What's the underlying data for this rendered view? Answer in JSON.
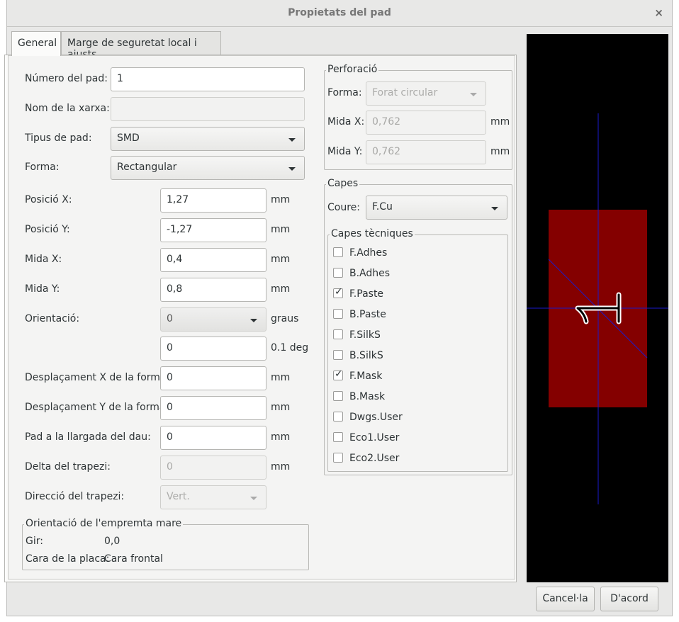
{
  "window": {
    "title": "Propietats del pad",
    "close_glyph": "×"
  },
  "tabs": [
    {
      "label": "General",
      "active": true
    },
    {
      "label": "Marge de seguretat local i ajusts",
      "active": false
    }
  ],
  "general": {
    "pad_number": {
      "label": "Número del pad:",
      "value": "1"
    },
    "net_name": {
      "label": "Nom de la xarxa:",
      "value": ""
    },
    "pad_type": {
      "label": "Tipus de pad:",
      "value": "SMD"
    },
    "shape": {
      "label": "Forma:",
      "value": "Rectangular"
    },
    "pos_x": {
      "label": "Posició X:",
      "value": "1,27",
      "unit": "mm"
    },
    "pos_y": {
      "label": "Posició Y:",
      "value": "-1,27",
      "unit": "mm"
    },
    "size_x": {
      "label": "Mida X:",
      "value": "0,4",
      "unit": "mm"
    },
    "size_y": {
      "label": "Mida Y:",
      "value": "0,8",
      "unit": "mm"
    },
    "orientation": {
      "label": "Orientació:",
      "value": "0",
      "unit": "graus",
      "value2": "0",
      "unit2": "0.1 deg"
    },
    "offset_x": {
      "label": "Desplaçament X de la forma:",
      "value": "0",
      "unit": "mm"
    },
    "offset_y": {
      "label": "Desplaçament Y de la forma:",
      "value": "0",
      "unit": "mm"
    },
    "die_length": {
      "label": "Pad a la llargada del dau:",
      "value": "0",
      "unit": "mm"
    },
    "trap_delta": {
      "label": "Delta del trapezi:",
      "value": "0",
      "unit": "mm"
    },
    "trap_dir": {
      "label": "Direcció del trapezi:",
      "value": "Vert."
    },
    "parent": {
      "legend": "Orientació de l'empremta mare",
      "rotation_label": "Gir:",
      "rotation_value": "0,0",
      "side_label": "Cara de la placa:",
      "side_value": "Cara frontal"
    }
  },
  "drill": {
    "legend": "Perforació",
    "shape_label": "Forma:",
    "shape_value": "Forat circular",
    "size_x_label": "Mida X:",
    "size_x_value": "0,762",
    "size_x_unit": "mm",
    "size_y_label": "Mida Y:",
    "size_y_value": "0,762",
    "size_y_unit": "mm"
  },
  "layers": {
    "legend": "Capes",
    "copper_label": "Coure:",
    "copper_value": "F.Cu",
    "tech_legend": "Capes tècniques",
    "tech": [
      {
        "name": "F.Adhes",
        "checked": false
      },
      {
        "name": "B.Adhes",
        "checked": false
      },
      {
        "name": "F.Paste",
        "checked": true
      },
      {
        "name": "B.Paste",
        "checked": false
      },
      {
        "name": "F.SilkS",
        "checked": false
      },
      {
        "name": "B.SilkS",
        "checked": false
      },
      {
        "name": "F.Mask",
        "checked": true
      },
      {
        "name": "B.Mask",
        "checked": false
      },
      {
        "name": "Dwgs.User",
        "checked": false
      },
      {
        "name": "Eco1.User",
        "checked": false
      },
      {
        "name": "Eco2.User",
        "checked": false
      }
    ]
  },
  "preview": {
    "pad_label": "1",
    "colors": {
      "background": "#000000",
      "pad": "#840000",
      "crosshair": "#1a1acc"
    }
  },
  "buttons": {
    "cancel": "Cancel·la",
    "ok": "D'acord"
  }
}
